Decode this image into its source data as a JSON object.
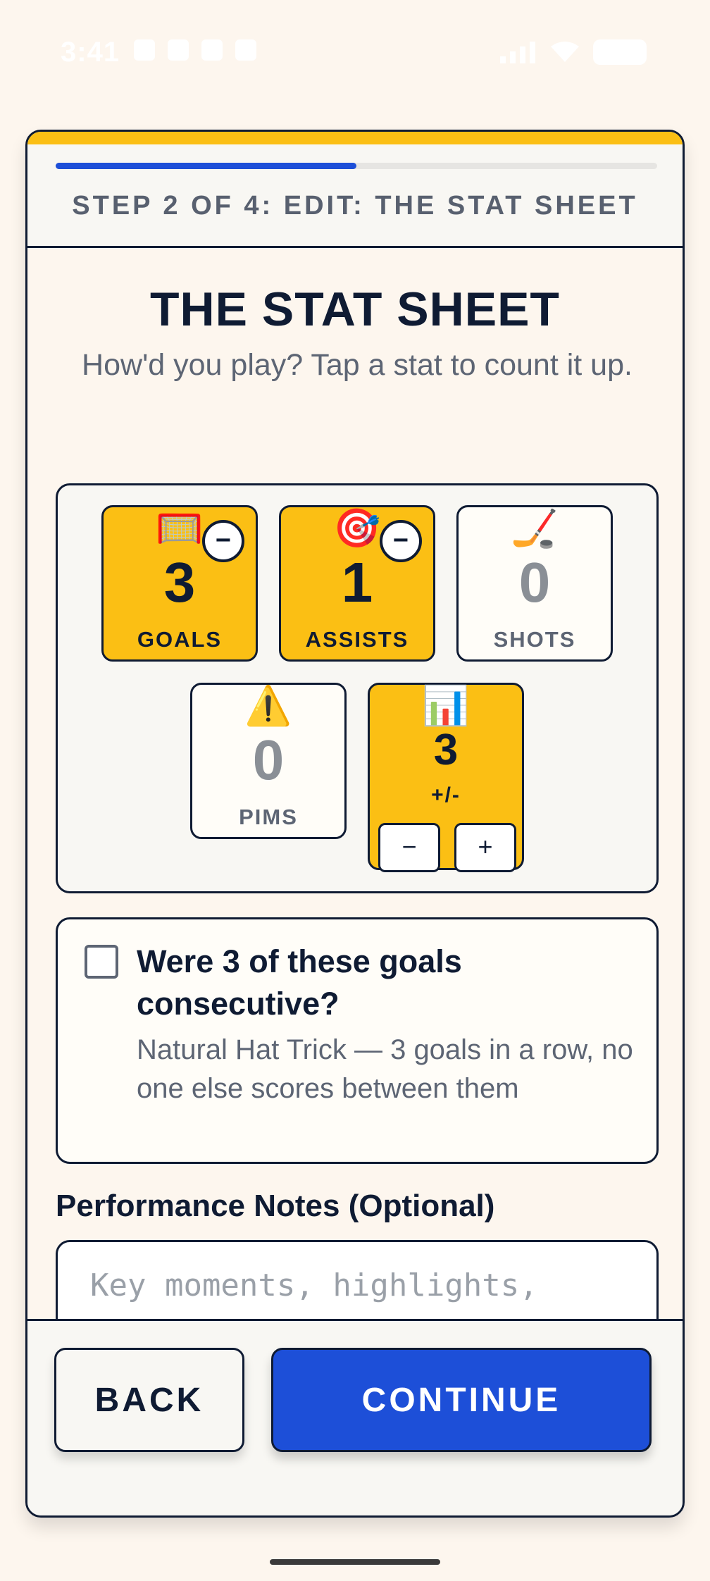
{
  "status_bar": {
    "time": "3:41",
    "left_icons": [
      "chat-bubble-icon",
      "mail-icon",
      "voicemail-icon",
      "sim-icon"
    ],
    "right_icons": [
      "signal-icon",
      "wifi-icon",
      "battery-icon"
    ]
  },
  "progress": {
    "fraction": 0.5,
    "step_label": "STEP 2 OF 4: EDIT: THE STAT SHEET"
  },
  "page": {
    "title": "THE STAT SHEET",
    "subtitle": "How'd you play? Tap a stat to count it up."
  },
  "stats": [
    {
      "icon": "goal-net-icon",
      "emoji": "🥅",
      "value": "3",
      "label": "GOALS",
      "active": true,
      "has_minus": true
    },
    {
      "icon": "target-icon",
      "emoji": "🎯",
      "value": "1",
      "label": "ASSISTS",
      "active": true,
      "has_minus": true
    },
    {
      "icon": "hockey-stick-icon",
      "emoji": "🏒",
      "value": "0",
      "label": "SHOTS",
      "active": false,
      "has_minus": false
    },
    {
      "icon": "warning-icon",
      "emoji": "⚠️",
      "value": "0",
      "label": "PIMS",
      "active": false,
      "has_minus": false
    },
    {
      "icon": "bar-chart-icon",
      "emoji": "📊",
      "value": "3",
      "label": "+/-",
      "active": true
    }
  ],
  "minus_symbol": "−",
  "plus_symbol": "+",
  "hat_trick": {
    "checked": false,
    "question": "Were 3 of these goals consecutive?",
    "description": "Natural Hat Trick — 3 goals in a row, no one else scores between them"
  },
  "notes": {
    "label": "Performance Notes (Optional)",
    "placeholder": "Key moments, highlights,",
    "value": ""
  },
  "footer": {
    "back_label": "BACK",
    "continue_label": "CONTINUE"
  },
  "colors": {
    "accent_yellow": "#fbbf14",
    "primary_blue": "#1d4fd8",
    "ink": "#0f1b33",
    "background": "#fdf6ee"
  }
}
